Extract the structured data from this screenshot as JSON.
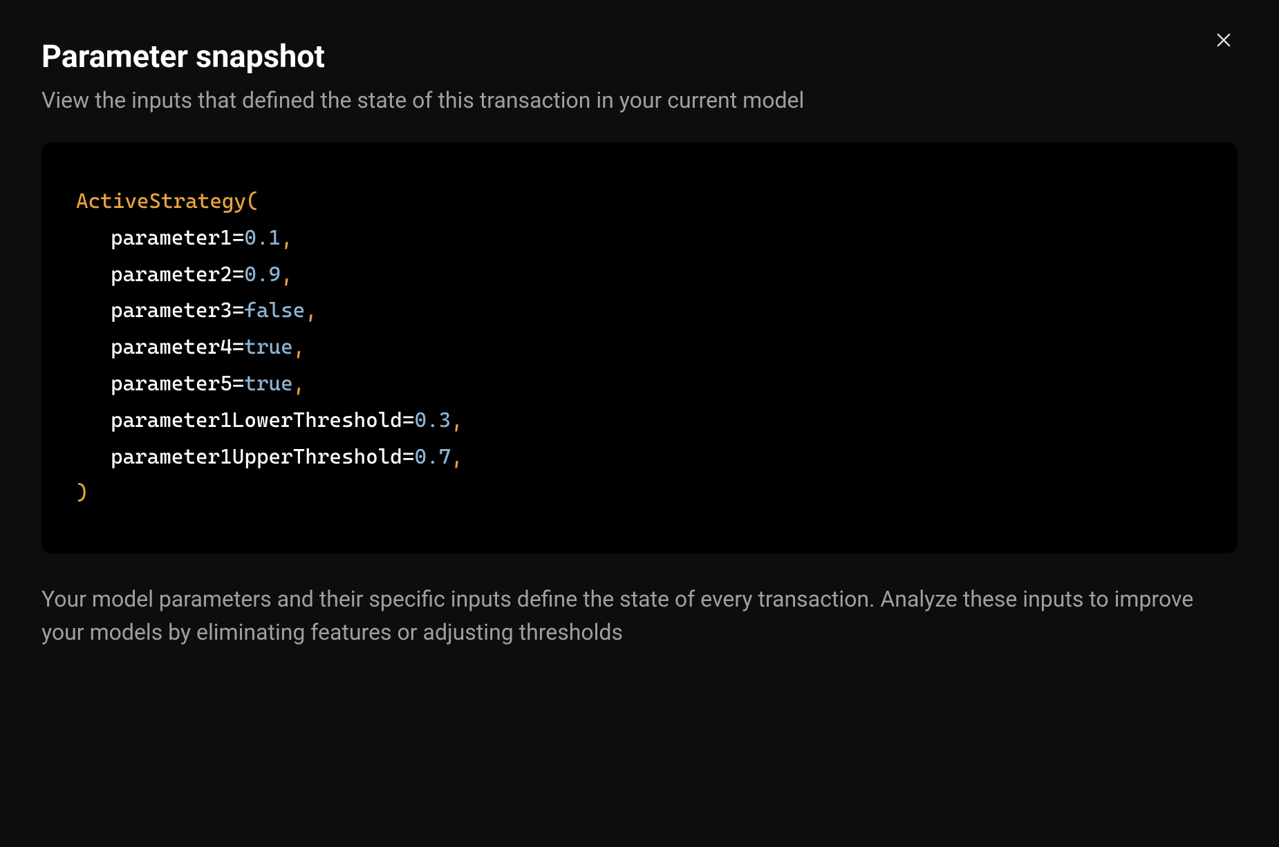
{
  "header": {
    "title": "Parameter snapshot",
    "subtitle": "View the inputs that defined the state of this transaction in your current model"
  },
  "code": {
    "functionName": "ActiveStrategy",
    "params": [
      {
        "name": "parameter1",
        "value": "0.1",
        "type": "num"
      },
      {
        "name": "parameter2",
        "value": "0.9",
        "type": "num"
      },
      {
        "name": "parameter3",
        "value": "false",
        "type": "bool"
      },
      {
        "name": "parameter4",
        "value": "true",
        "type": "bool"
      },
      {
        "name": "parameter5",
        "value": "true",
        "type": "bool"
      },
      {
        "name": "parameter1LowerThreshold",
        "value": "0.3",
        "type": "num"
      },
      {
        "name": "parameter1UpperThreshold",
        "value": "0.7",
        "type": "num"
      }
    ]
  },
  "footer": {
    "text": "Your model parameters and their specific inputs define the state of every transaction. Analyze these inputs to improve your models by eliminating features or adjusting thresholds"
  }
}
